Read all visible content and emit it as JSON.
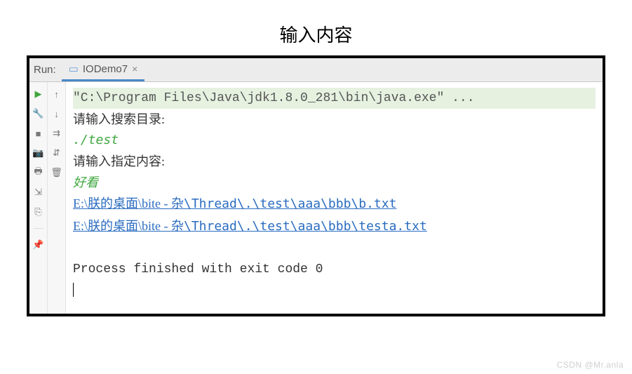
{
  "title": "输入内容",
  "tabbar": {
    "run_label": "Run:",
    "tab_name": "IODemo7",
    "close_label": "×"
  },
  "icons": {
    "play": "▶",
    "wrench": "🔧",
    "stop": "■",
    "camera": "📷",
    "print": "🖶",
    "structure": "⇲",
    "exit": "⎘",
    "pin": "📌",
    "up": "↑",
    "down": "↓",
    "wrap": "⇉",
    "scroll": "⇵",
    "trash": "🗑"
  },
  "console": {
    "cmd": "\"C:\\Program Files\\Java\\jdk1.8.0_281\\bin\\java.exe\" ...",
    "prompt1": "请输入搜索目录:",
    "input1": "./test",
    "prompt2": "请输入指定内容:",
    "input2": "好看",
    "paths": [
      {
        "prefix": "E:\\朕的桌面",
        "mid": "\\bite - 杂",
        "rest": "\\Thread\\.\\test\\aaa\\bbb\\b.txt"
      },
      {
        "prefix": "E:\\朕的桌面",
        "mid": "\\bite - 杂",
        "rest": "\\Thread\\.\\test\\aaa\\bbb\\testa.txt"
      }
    ],
    "process": "Process finished with exit code 0"
  },
  "watermark": "CSDN @Mr.anla"
}
